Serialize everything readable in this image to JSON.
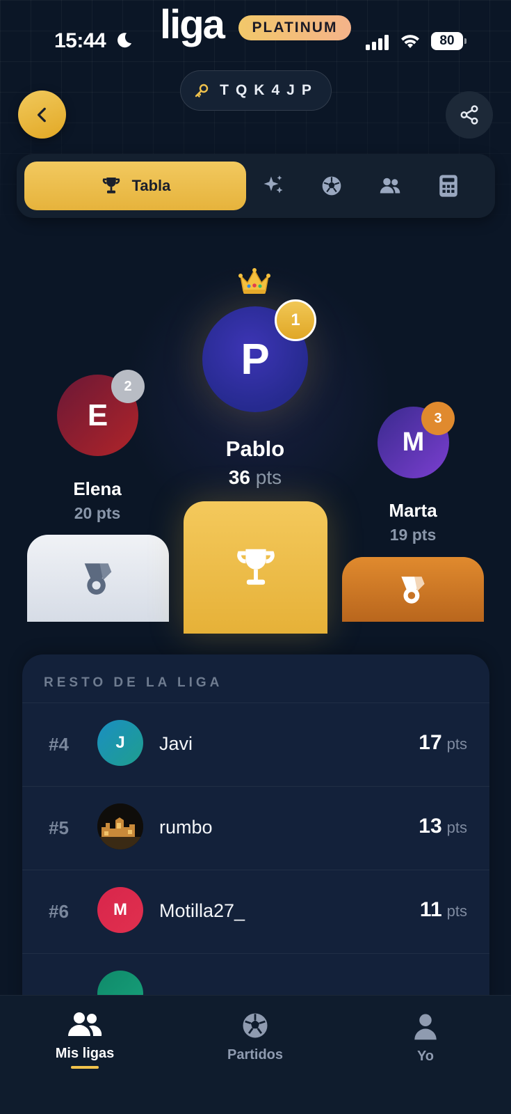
{
  "status_bar": {
    "time": "15:44",
    "battery": "80"
  },
  "header": {
    "app_title": "liga",
    "tier": "PLATINUM",
    "league_code": "TQK4JP"
  },
  "tabs": {
    "active_label": "Tabla",
    "icons": [
      "trophy-icon",
      "sparkles-icon",
      "soccer-ball-icon",
      "people-icon",
      "calculator-icon"
    ]
  },
  "podium": {
    "first": {
      "initial": "P",
      "name": "Pablo",
      "points": "36",
      "rank": "1"
    },
    "second": {
      "initial": "E",
      "name": "Elena",
      "points": "20",
      "rank": "2"
    },
    "third": {
      "initial": "M",
      "name": "Marta",
      "points": "19",
      "rank": "3"
    },
    "pts_unit": "pts"
  },
  "rest": {
    "title": "RESTO DE LA LIGA",
    "rows": [
      {
        "rank": "#4",
        "initial": "J",
        "name": "Javi",
        "points": "17",
        "unit": "pts",
        "color": "#1a8fc2"
      },
      {
        "rank": "#5",
        "initial": "",
        "name": "rumbo",
        "points": "13",
        "unit": "pts",
        "color": "#2a2216"
      },
      {
        "rank": "#6",
        "initial": "M",
        "name": "Motilla27_",
        "points": "11",
        "unit": "pts",
        "color": "#d8264c"
      }
    ]
  },
  "bottom_nav": {
    "items": [
      {
        "label": "Mis ligas",
        "icon": "people-icon",
        "active": true
      },
      {
        "label": "Partidos",
        "icon": "soccer-ball-icon",
        "active": false
      },
      {
        "label": "Yo",
        "icon": "person-icon",
        "active": false
      }
    ]
  },
  "colors": {
    "accent": "#f0c24c",
    "background": "#0b1626",
    "card": "#13213a",
    "bronze": "#e08a2e"
  }
}
